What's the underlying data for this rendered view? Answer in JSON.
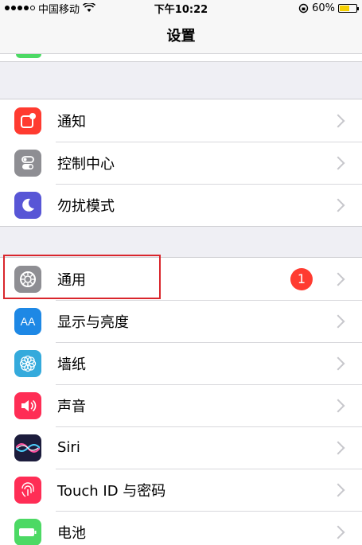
{
  "status_bar": {
    "carrier": "中国移动",
    "time": "下午10:22",
    "battery": "60%",
    "battery_level": 0.6
  },
  "nav": {
    "title": "设置"
  },
  "groups": [
    {
      "items": [
        {
          "label": "通知",
          "icon": "notifications-icon",
          "color": "#ff3b30"
        },
        {
          "label": "控制中心",
          "icon": "control-center-icon",
          "color": "#8e8e93"
        },
        {
          "label": "勿扰模式",
          "icon": "moon-icon",
          "color": "#5856d6"
        }
      ]
    },
    {
      "items": [
        {
          "label": "通用",
          "icon": "gear-icon",
          "color": "#8e8e93",
          "badge": "1"
        },
        {
          "label": "显示与亮度",
          "icon": "display-icon",
          "color": "#1e88e5",
          "icon_text": "AA"
        },
        {
          "label": "墙纸",
          "icon": "flower-icon",
          "color": "#34aadc"
        },
        {
          "label": "声音",
          "icon": "speaker-icon",
          "color": "#ff2d55"
        },
        {
          "label": "Siri",
          "icon": "siri-icon",
          "color": "#1c1c3c"
        },
        {
          "label": "Touch ID 与密码",
          "icon": "fingerprint-icon",
          "color": "#ff2d55"
        },
        {
          "label": "电池",
          "icon": "battery-icon",
          "color": "#4cd964"
        }
      ]
    }
  ]
}
